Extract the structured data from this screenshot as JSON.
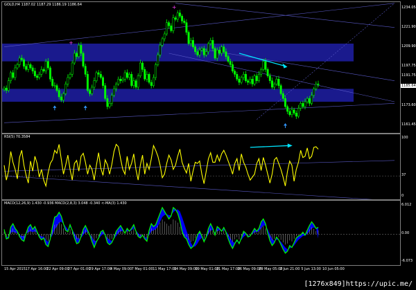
{
  "main": {
    "title": "GOLD,H4 1187.02 1187.29 1186.19 1186.64",
    "y_labels": [
      "1234.05",
      "1221.90",
      "1209.90",
      "1197.75",
      "1191.75",
      "1185.64",
      "1173.60",
      "1161.45"
    ],
    "current_price": "1185.64"
  },
  "rsi": {
    "title": "RSI(5) 70.3584",
    "y_labels": [
      "100",
      "37",
      "0"
    ]
  },
  "macd": {
    "title": "MACD(12,26,9) 1.430 -0.936 MACD(2,8,3) 3.048 -0.340 <-MA(3) 1.430",
    "y_labels": [
      "6.012",
      "0.00",
      "-6.073"
    ]
  },
  "x_labels": [
    "15 Apr 2015",
    "17 Apr 16:00",
    "22 Apr 09:00",
    "27 Apr 01:00",
    "29 Apr 17:00",
    "4 May 09:00",
    "7 May 01:00",
    "11 May 17:00",
    "14 May 09:00",
    "19 May 01:00",
    "21 May 17:00",
    "26 May 09:00",
    "29 May 05:00",
    "2 Jun 21:00",
    "5 Jun 13:00",
    "10 Jun 05:00"
  ],
  "badge": "[1276x849]https://upic.me/",
  "colors": {
    "bull": "#00ff00",
    "zone": "#1f1fa6",
    "rsi": "#ffff00",
    "macd_line": "#00ff00",
    "macd_area": "#0000ff",
    "arrow": "#00e5ff",
    "marker": "#3399ff"
  },
  "chart_data": [
    {
      "type": "candlestick",
      "title": "GOLD,H4 1187.02 1187.29 1186.19 1186.64",
      "ylim": [
        1158,
        1236
      ],
      "close_path": [
        1184.5,
        1183,
        1189,
        1194,
        1191,
        1197,
        1199,
        1203,
        1202,
        1198,
        1196,
        1199,
        1197,
        1195,
        1192,
        1191,
        1193,
        1196,
        1195,
        1201,
        1197,
        1190,
        1186,
        1186,
        1183,
        1179,
        1177,
        1181,
        1187,
        1191,
        1193,
        1200,
        1206,
        1204,
        1211,
        1206,
        1198,
        1193,
        1183,
        1181,
        1185,
        1189,
        1194,
        1193,
        1191,
        1186,
        1178,
        1173,
        1175,
        1180,
        1184,
        1187,
        1190,
        1189,
        1190,
        1194,
        1191,
        1193,
        1186,
        1189,
        1185,
        1192,
        1200,
        1196,
        1190,
        1193,
        1188,
        1186,
        1191,
        1199,
        1205,
        1211,
        1215,
        1218,
        1225,
        1223,
        1220,
        1228,
        1227,
        1231,
        1229,
        1226,
        1225,
        1219,
        1212,
        1214,
        1210,
        1207,
        1205,
        1208,
        1209,
        1205,
        1207,
        1212,
        1214,
        1209,
        1203,
        1208,
        1206,
        1210,
        1207,
        1204,
        1201,
        1199,
        1195,
        1193,
        1190,
        1188,
        1191,
        1193,
        1189,
        1188,
        1190,
        1187,
        1192,
        1189,
        1193,
        1196,
        1201,
        1196,
        1192,
        1189,
        1185,
        1187,
        1190,
        1186,
        1181,
        1178,
        1173,
        1170,
        1168,
        1171,
        1169,
        1167,
        1172,
        1175,
        1173,
        1176,
        1178,
        1175,
        1180,
        1184,
        1187,
        1186.64
      ],
      "zones": [
        [
          1201,
          1212
        ],
        [
          1176,
          1184
        ]
      ],
      "trendlines": [
        {
          "from": [
            0,
            1163
          ],
          "to": [
            143,
            1175
          ]
        },
        {
          "from": [
            0,
            1210
          ],
          "to": [
            143,
            1237
          ]
        },
        {
          "from": [
            78,
            1237
          ],
          "to": [
            143,
            1222
          ]
        },
        {
          "from": [
            75,
            1206
          ],
          "to": [
            143,
            1176
          ]
        },
        {
          "from": [
            88,
            1209
          ],
          "to": [
            143,
            1189
          ]
        },
        {
          "from": [
            115,
            1165
          ],
          "to": [
            143,
            1237
          ]
        }
      ],
      "arrow": {
        "from": [
          107,
          1206
        ],
        "to": [
          128,
          1198
        ]
      },
      "swing_highs": [
        [
          30,
          1211
        ],
        [
          77,
          1233
        ]
      ],
      "swing_lows": [
        [
          23,
          1175
        ],
        [
          37,
          1175
        ],
        [
          128,
          1164
        ]
      ]
    },
    {
      "type": "line",
      "title": "RSI(5) 70.3584",
      "ylim": [
        0,
        100
      ],
      "levels": [
        37
      ],
      "values": [
        55,
        30,
        45,
        78,
        60,
        48,
        32,
        68,
        80,
        55,
        38,
        25,
        62,
        45,
        70,
        58,
        35,
        48,
        30,
        20,
        42,
        58,
        64,
        80,
        75,
        90,
        65,
        40,
        55,
        72,
        48,
        30,
        58,
        63,
        45,
        70,
        75,
        60,
        40,
        55,
        48,
        30,
        55,
        76,
        50,
        38,
        64,
        56,
        40,
        56,
        78,
        90,
        86,
        66,
        48,
        40,
        70,
        48,
        58,
        74,
        48,
        30,
        55,
        72,
        40,
        58,
        48,
        66,
        88,
        80,
        70,
        55,
        34,
        40,
        58,
        72,
        64,
        48,
        55,
        70,
        82,
        60,
        50,
        42,
        58,
        28,
        45,
        60,
        58,
        62,
        40,
        24,
        45,
        66,
        76,
        60,
        60,
        72,
        62,
        74,
        80,
        72,
        62,
        52,
        40,
        58,
        66,
        46,
        74,
        60,
        52,
        40,
        30,
        35,
        40,
        58,
        66,
        46,
        68,
        55,
        40,
        25,
        40,
        64,
        68,
        58,
        48,
        35,
        20,
        45,
        62,
        55,
        28,
        48,
        60,
        80,
        68,
        70,
        84,
        66,
        70,
        85,
        86,
        82
      ],
      "trendlines": [
        {
          "from": [
            0,
            45
          ],
          "to": [
            143,
            63
          ]
        },
        {
          "from": [
            0,
            37
          ],
          "to": [
            143,
            -5
          ]
        }
      ],
      "arrow": {
        "from": [
          112,
          85
        ],
        "to": [
          130,
          88
        ]
      }
    },
    {
      "type": "area",
      "title": "MACD(12,26,9) 1.430 -0.936 MACD(2,8,3) 3.048 -0.340 <-MA(3) 1.430",
      "ylim": [
        -6.073,
        6.012
      ],
      "macd_line": [
        1.0,
        -1.0,
        -0.8,
        1.5,
        2.2,
        1.2,
        0.6,
        -0.5,
        -1.2,
        -1.5,
        0.2,
        1.5,
        2.0,
        1.0,
        1.6,
        0.5,
        -0.6,
        -1.2,
        -0.8,
        -2.2,
        -2.6,
        -1.0,
        1.6,
        3.6,
        3.8,
        4.6,
        3.8,
        2.2,
        0.8,
        0.5,
        2.0,
        0.8,
        -0.8,
        -2.0,
        -1.8,
        -0.5,
        1.0,
        1.8,
        0.8,
        -0.2,
        -1.6,
        -2.8,
        -1.6,
        -0.8,
        0.5,
        0.8,
        -0.2,
        -1.8,
        -2.2,
        -1.8,
        -0.8,
        0.6,
        1.2,
        1.8,
        1.0,
        0.2,
        1.2,
        0.6,
        1.2,
        2.0,
        0.6,
        -0.5,
        -0.8,
        -0.2,
        -1.0,
        -1.5,
        0.8,
        2.2,
        1.6,
        2.0,
        3.2,
        4.4,
        5.6,
        4.8,
        4.0,
        3.2,
        3.8,
        5.6,
        5.2,
        4.4,
        2.8,
        0.6,
        -0.6,
        -1.0,
        -2.2,
        -3.0,
        -2.6,
        -1.6,
        -0.2,
        0.6,
        -0.4,
        -1.6,
        -0.6,
        1.2,
        2.2,
        1.2,
        -0.2,
        1.6,
        1.2,
        0.6,
        1.4,
        0.4,
        -1.0,
        -2.2,
        -3.0,
        -2.0,
        -1.2,
        -2.0,
        -0.8,
        0.6,
        0.2,
        -0.6,
        -0.4,
        0.4,
        1.2,
        0.6,
        1.2,
        2.6,
        3.2,
        2.2,
        0.2,
        -1.4,
        -2.4,
        -1.8,
        -0.6,
        -1.2,
        -2.2,
        -3.2,
        -4.0,
        -3.6,
        -2.4,
        -2.8,
        -1.8,
        -0.8,
        -0.4,
        -0.2,
        0.4,
        -0.2,
        0.8,
        1.8,
        2.6,
        2.0,
        1.2,
        1.43
      ],
      "signal_area": [
        0.5,
        -0.6,
        -0.5,
        0.3,
        0.5,
        0.3,
        0.2,
        -0.2,
        -0.4,
        -0.4,
        0.1,
        0.4,
        0.6,
        0.4,
        0.6,
        0.2,
        -0.2,
        -0.5,
        -0.5,
        -1.2,
        -1.6,
        -1.0,
        -0.2,
        1.0,
        1.6,
        2.4,
        2.6,
        2.2,
        1.6,
        1.0,
        1.4,
        1.0,
        0.2,
        -0.6,
        -1.0,
        -0.8,
        -0.2,
        0.4,
        0.4,
        0.0,
        -0.6,
        -1.4,
        -1.4,
        -1.0,
        -0.4,
        0.0,
        -0.2,
        -0.8,
        -1.2,
        -1.4,
        -1.0,
        -0.4,
        0.2,
        0.6,
        0.6,
        0.4,
        0.6,
        0.6,
        0.8,
        1.2,
        0.8,
        0.2,
        -0.2,
        -0.2,
        -0.6,
        -0.8,
        -0.2,
        0.6,
        0.8,
        1.0,
        1.6,
        2.6,
        3.6,
        4.0,
        4.2,
        4.0,
        4.0,
        4.6,
        5.0,
        5.2,
        4.8,
        3.6,
        2.2,
        0.8,
        -0.6,
        -1.8,
        -2.6,
        -2.6,
        -2.0,
        -1.2,
        -0.8,
        -1.0,
        -0.8,
        0.0,
        0.8,
        0.8,
        0.4,
        0.6,
        0.8,
        0.6,
        0.8,
        0.6,
        0.0,
        -0.8,
        -1.6,
        -1.8,
        -1.6,
        -1.6,
        -1.2,
        -0.6,
        -0.2,
        -0.3,
        -0.3,
        0.0,
        0.4,
        0.4,
        0.6,
        1.2,
        1.8,
        1.8,
        1.0,
        0.0,
        -1.0,
        -1.4,
        -1.2,
        -1.2,
        -1.6,
        -2.2,
        -2.8,
        -3.2,
        -3.0,
        -2.8,
        -2.4,
        -1.8,
        -1.2,
        -0.8,
        -0.4,
        -0.3,
        0.0,
        0.6,
        1.2,
        1.4,
        1.2,
        -0.936
      ]
    }
  ]
}
